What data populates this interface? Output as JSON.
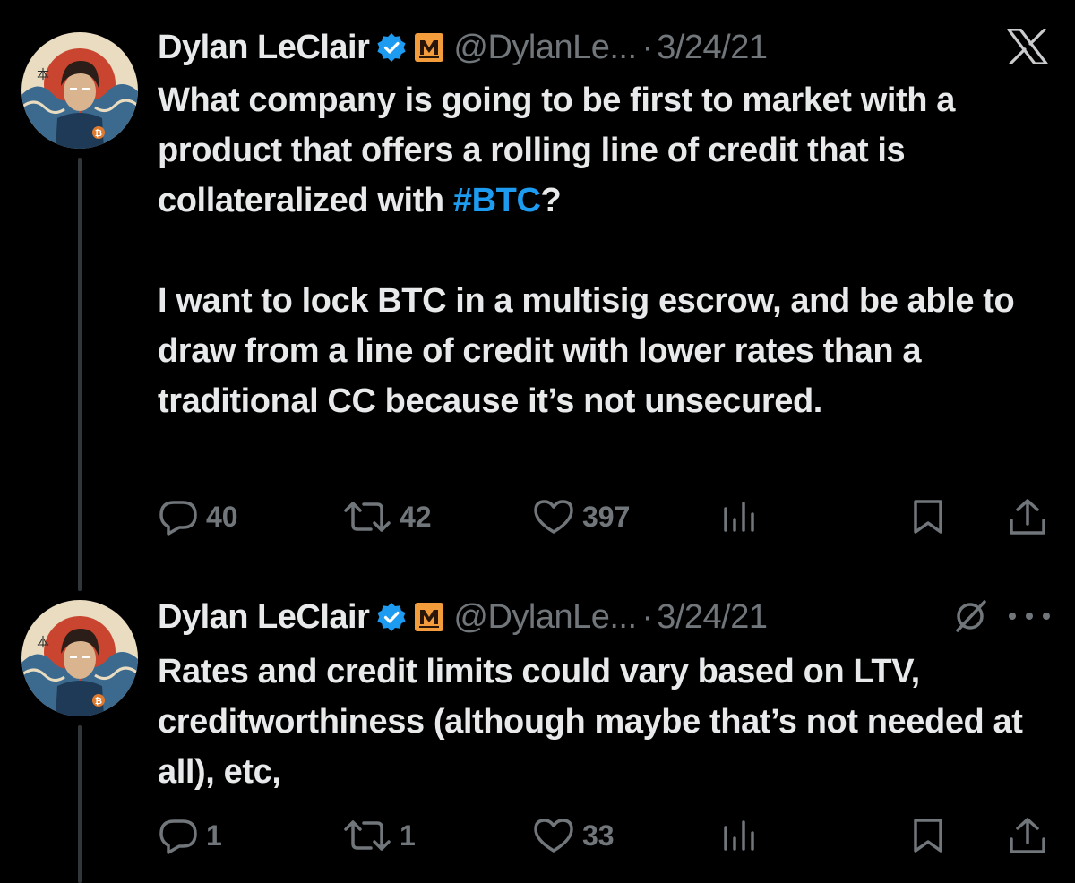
{
  "tweets": [
    {
      "display_name": "Dylan LeClair",
      "handle": "@DylanLe...",
      "separator": "·",
      "date": "3/24/21",
      "text_paragraphs": [
        {
          "before": "What company is going to be first to market with a product that offers a rolling line of credit that is collateralized with ",
          "hashtag": "#BTC",
          "after": "?"
        },
        {
          "before": "I want to lock BTC in a multisig escrow, and be able to draw from a line of credit with lower rates than a traditional CC because it’s not unsecured.",
          "hashtag": "",
          "after": ""
        }
      ],
      "actions": {
        "replies": "40",
        "reposts": "42",
        "likes": "397"
      }
    },
    {
      "display_name": "Dylan LeClair",
      "handle": "@DylanLe...",
      "separator": "·",
      "date": "3/24/21",
      "text_paragraphs": [
        {
          "before": "Rates and credit limits could vary based on LTV, creditworthiness (although maybe that’s not needed at all), etc,",
          "hashtag": "",
          "after": ""
        }
      ],
      "actions": {
        "replies": "1",
        "reposts": "1",
        "likes": "33"
      }
    }
  ],
  "icons": {
    "top_right": "x-logo",
    "verified": "verified-badge-icon",
    "affiliate": "affiliate-badge-icon",
    "grok": "grok-icon",
    "more": "more-options-icon",
    "reply": "reply-icon",
    "repost": "repost-icon",
    "like": "like-icon",
    "views": "views-icon",
    "bookmark": "bookmark-icon",
    "share": "share-icon"
  },
  "colors": {
    "background": "#000000",
    "text": "#e7e9ea",
    "secondary": "#71767b",
    "accent": "#1d9bf0",
    "thread_line": "#333639",
    "affiliate_badge": "#f39c3c"
  }
}
